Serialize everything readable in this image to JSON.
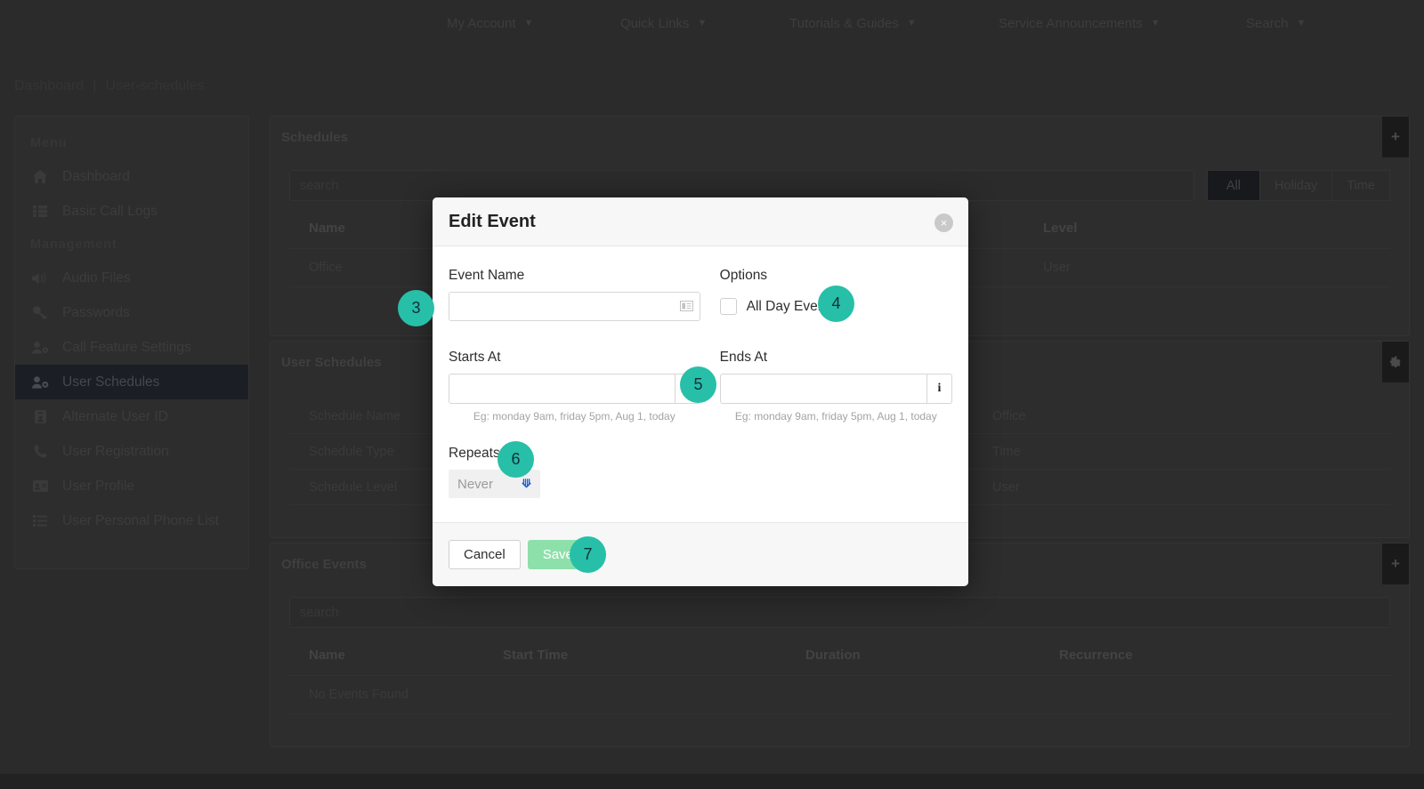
{
  "topnav": {
    "items": [
      {
        "label": "My Account",
        "icon": "chevron-down-icon"
      },
      {
        "label": "Quick Links",
        "icon": "chevron-down-icon"
      },
      {
        "label": "Tutorials & Guides",
        "icon": "chevron-down-icon"
      },
      {
        "label": "Service Announcements",
        "icon": "chevron-down-icon"
      },
      {
        "label": "Search",
        "icon": "chevron-down-icon"
      }
    ]
  },
  "breadcrumb": {
    "root": "Dashboard",
    "separator": "|",
    "current": "User-schedules"
  },
  "sidebar": {
    "groups": [
      {
        "title": "Menu",
        "items": [
          {
            "label": "Dashboard",
            "icon": "home-icon",
            "active": false
          },
          {
            "label": "Basic Call Logs",
            "icon": "list-icon",
            "active": false
          }
        ]
      },
      {
        "title": "Management",
        "items": [
          {
            "label": "Audio Files",
            "icon": "speaker-icon",
            "active": false
          },
          {
            "label": "Passwords",
            "icon": "key-icon",
            "active": false
          },
          {
            "label": "Call Feature Settings",
            "icon": "user-gear-icon",
            "active": false
          },
          {
            "label": "User Schedules",
            "icon": "user-clock-icon",
            "active": true
          },
          {
            "label": "Alternate User ID",
            "icon": "id-badge-icon",
            "active": false
          },
          {
            "label": "User Registration",
            "icon": "phone-icon",
            "active": false
          },
          {
            "label": "User Profile",
            "icon": "id-card-icon",
            "active": false
          },
          {
            "label": "User Personal Phone List",
            "icon": "list-icon",
            "active": false
          }
        ]
      }
    ]
  },
  "schedules_panel": {
    "title": "Schedules",
    "add_button": "+",
    "search_placeholder": "search",
    "filters": [
      {
        "label": "All",
        "active": true
      },
      {
        "label": "Holiday",
        "active": false
      },
      {
        "label": "Time",
        "active": false
      }
    ],
    "columns": [
      "Name",
      "Level"
    ],
    "rows": [
      {
        "name": "Office",
        "level": "User"
      }
    ]
  },
  "user_schedules_panel": {
    "title": "User Schedules",
    "settings_button": "gear",
    "rows": [
      {
        "key": "Schedule Name",
        "value": "Office"
      },
      {
        "key": "Schedule Type",
        "value": "Time"
      },
      {
        "key": "Schedule Level",
        "value": "User"
      }
    ]
  },
  "office_events_panel": {
    "title": "Office Events",
    "add_button": "+",
    "search_placeholder": "search",
    "columns": [
      "Name",
      "Start Time",
      "Duration",
      "Recurrence"
    ],
    "empty_text": "No Events Found"
  },
  "modal": {
    "title": "Edit Event",
    "close_label": "×",
    "event_name": {
      "label": "Event Name",
      "value": "",
      "placeholder": "",
      "icon": "contact-card-icon"
    },
    "options": {
      "label": "Options",
      "all_day": {
        "label": "All Day Event",
        "checked": false
      }
    },
    "starts_at": {
      "label": "Starts At",
      "value": "",
      "info_icon": "i",
      "hint": "Eg: monday 9am, friday 5pm, Aug 1, today"
    },
    "ends_at": {
      "label": "Ends At",
      "value": "",
      "info_icon": "i",
      "hint": "Eg: monday 9am, friday 5pm, Aug 1, today"
    },
    "repeats": {
      "label": "Repeats",
      "selected": "Never",
      "chevron": "chevron-down-icon"
    },
    "footer": {
      "cancel": "Cancel",
      "save": "Save"
    }
  },
  "annotations": {
    "badges": [
      {
        "number": "3"
      },
      {
        "number": "4"
      },
      {
        "number": "5"
      },
      {
        "number": "6"
      },
      {
        "number": "7"
      }
    ]
  },
  "colors": {
    "badge_teal": "#27bfa8",
    "save_green": "#8ee0aa",
    "page_bg": "#2b2b2b",
    "panel_bg": "#2d2d2d",
    "modal_bg": "#ffffff",
    "chevron_blue": "#1e5fd8"
  }
}
